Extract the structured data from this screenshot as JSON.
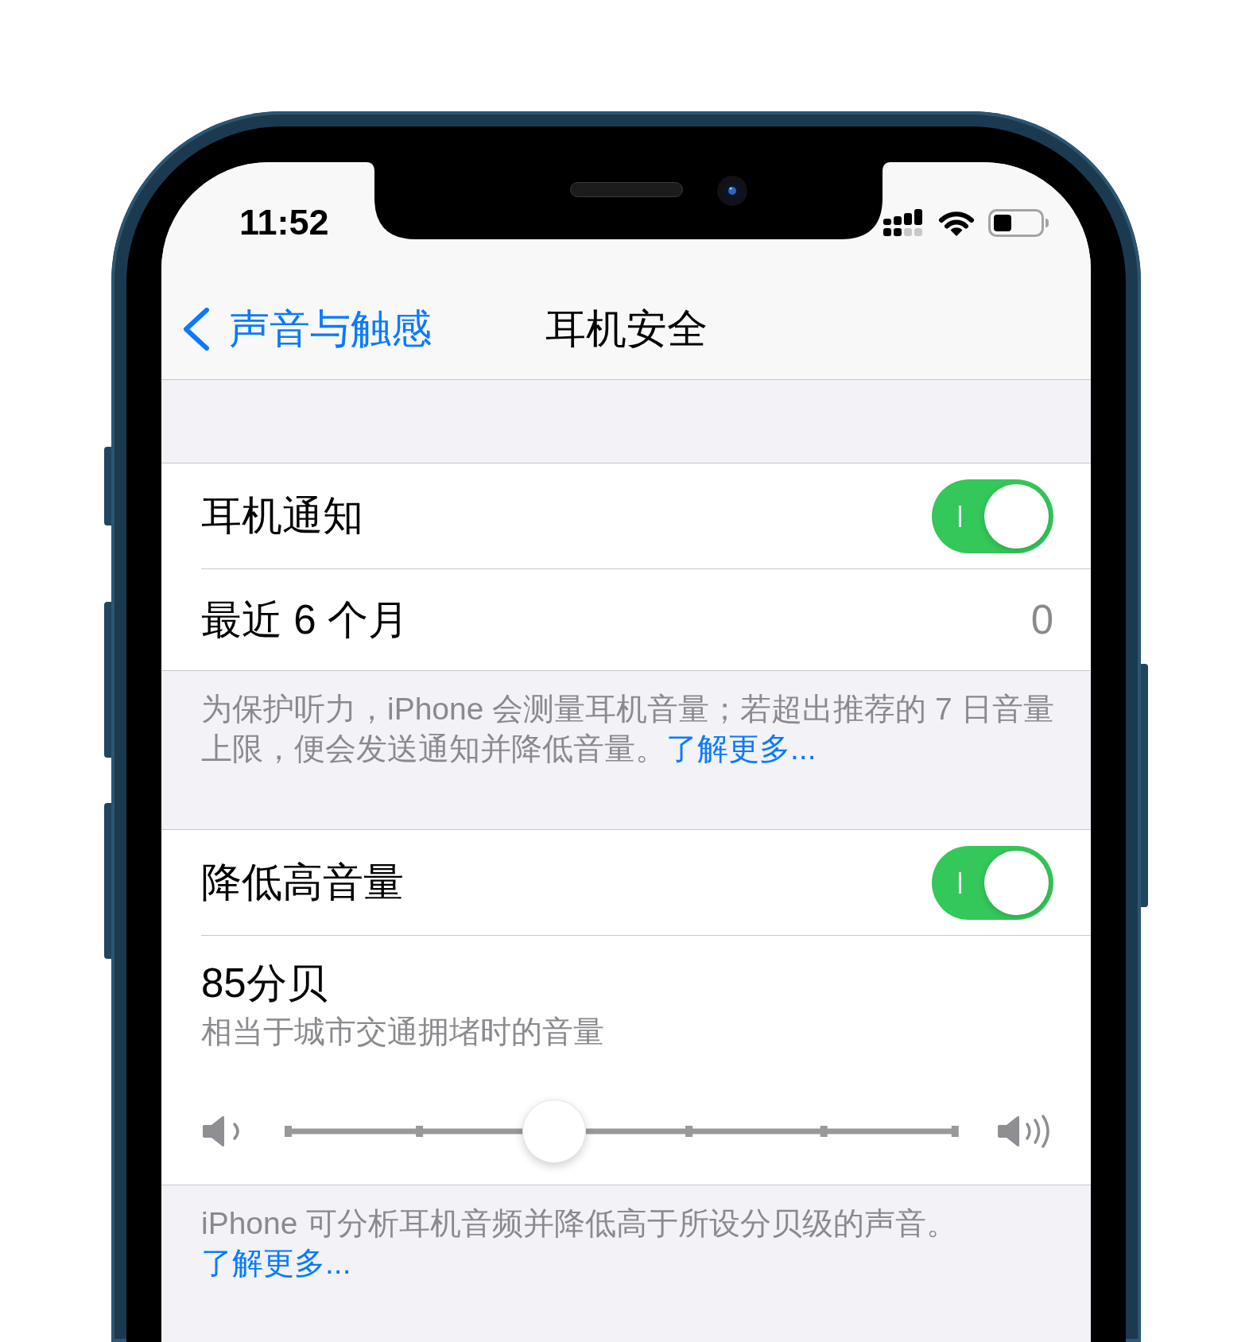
{
  "status_bar": {
    "time": "11:52"
  },
  "navigation_bar": {
    "back_label": "声音与触感",
    "title": "耳机安全"
  },
  "sections": [
    {
      "rows": [
        {
          "kind": "toggle",
          "label": "耳机通知",
          "on": true
        },
        {
          "kind": "value",
          "label": "最近 6 个月",
          "value": "0"
        }
      ],
      "footer": {
        "text": "为保护听力，iPhone 会测量耳机音量；若超出推荐的 7 日音量上限，便会发送通知并降低音量。",
        "link": "了解更多..."
      }
    },
    {
      "rows": [
        {
          "kind": "toggle",
          "label": "降低高音量",
          "on": true
        },
        {
          "kind": "slider",
          "label": "85分贝",
          "subtitle": "相当于城市交通拥堵时的音量",
          "level": 0.4
        }
      ],
      "footer": {
        "text": "iPhone 可分析耳机音频并降低高于所设分贝级的声音。",
        "link": "了解更多..."
      }
    }
  ]
}
